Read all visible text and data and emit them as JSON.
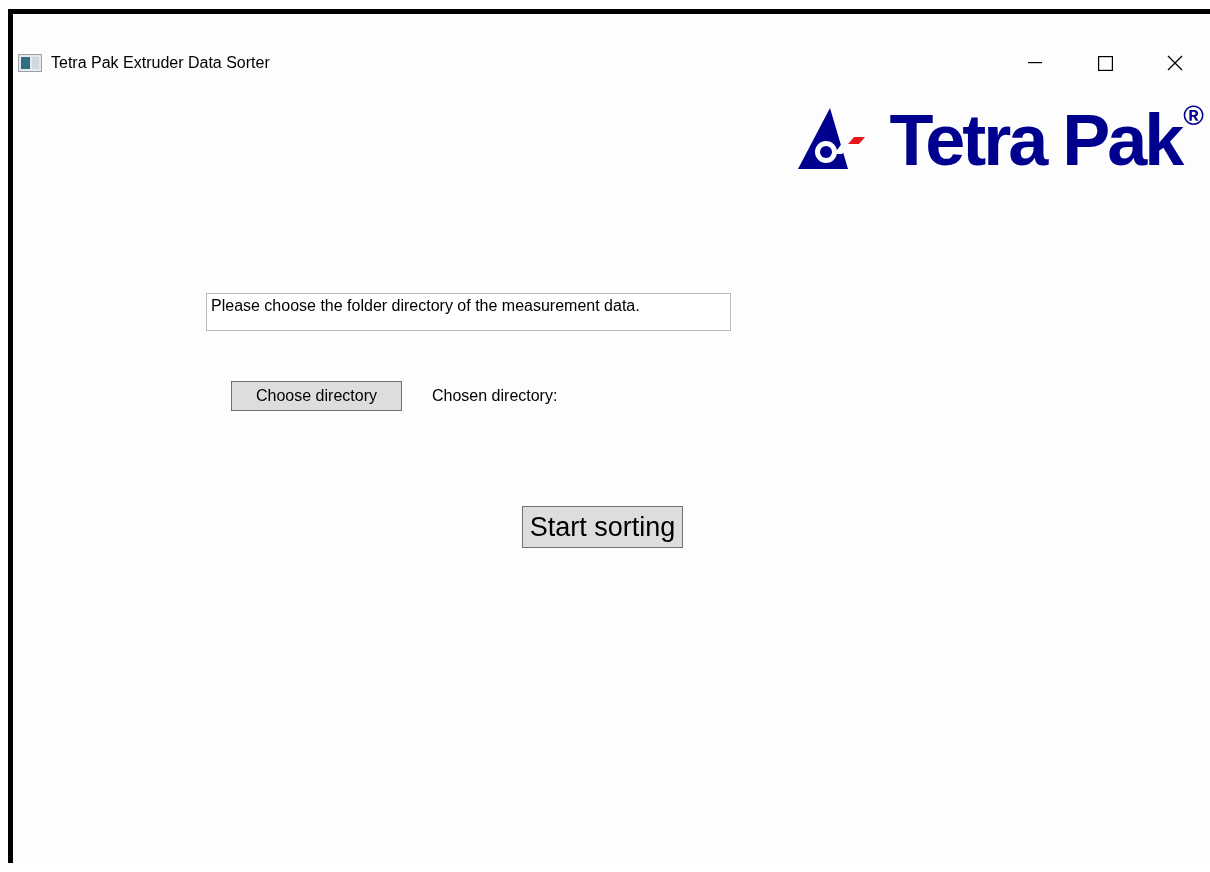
{
  "window": {
    "title": "Tetra Pak Extruder Data Sorter"
  },
  "logo": {
    "wordmark": "Tetra Pak",
    "registered": "®"
  },
  "message_field": {
    "value": "Please choose the folder directory of the measurement data."
  },
  "choose_button": {
    "label": "Choose directory"
  },
  "chosen_label": "Chosen directory:",
  "start_button": {
    "label": "Start sorting"
  }
}
